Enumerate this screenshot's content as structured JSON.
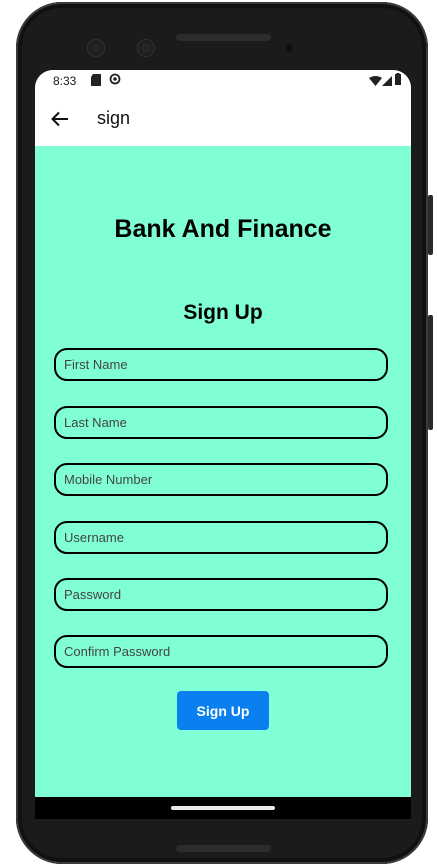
{
  "status_bar": {
    "time": "8:33",
    "icons": [
      "sd-card-icon",
      "sync-icon",
      "wifi-icon",
      "signal-icon",
      "battery-icon"
    ]
  },
  "app_bar": {
    "back_icon": "arrow-left-icon",
    "title": "sign"
  },
  "page": {
    "brand_title": "Bank And Finance",
    "form_title": "Sign Up"
  },
  "form": {
    "fields": [
      {
        "placeholder": "First Name",
        "value": ""
      },
      {
        "placeholder": "Last Name",
        "value": ""
      },
      {
        "placeholder": "Mobile Number",
        "value": ""
      },
      {
        "placeholder": "Username",
        "value": ""
      },
      {
        "placeholder": "Password",
        "value": ""
      },
      {
        "placeholder": "Confirm Password",
        "value": ""
      }
    ],
    "submit_label": "Sign Up"
  },
  "colors": {
    "background": "#80ffd6",
    "button": "#0a80f0",
    "bars": "#ffffff"
  }
}
